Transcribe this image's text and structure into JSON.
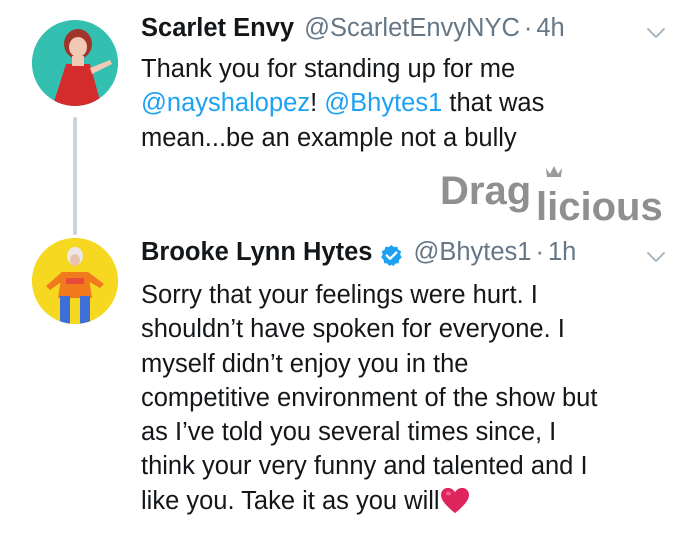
{
  "tweets": [
    {
      "display_name": "Scarlet Envy",
      "handle": "@ScarletEnvyNYC",
      "separator": "·",
      "time": "4h",
      "body": {
        "line1": "Thank you for standing up for me",
        "mention1": "@nayshalopez",
        "line2_mid": "! ",
        "mention2": "@Bhytes1",
        "line2_end": " that was",
        "line3": "mean...be an example not a bully"
      },
      "avatar_icon": "drag-queen-red-dress-avatar",
      "menu_icon": "chevron-down-icon"
    },
    {
      "display_name": "Brooke Lynn Hytes",
      "verified": true,
      "handle": "@Bhytes1",
      "separator": "·",
      "time": "1h",
      "body": {
        "lines": [
          "Sorry that your feelings were hurt. I",
          "shouldn’t have spoken for everyone. I",
          "myself didn’t enjoy you in the",
          "competitive environment of the show but",
          "as I’ve told you several times since, I",
          "think your very funny and talented and I",
          "like you.  Take it as you will"
        ],
        "emoji": "red-heart"
      },
      "avatar_icon": "drag-queen-orange-outfit-avatar",
      "menu_icon": "chevron-down-icon"
    }
  ],
  "watermark": {
    "text_a": "Drag",
    "text_b": "licious"
  },
  "colors": {
    "text": "#14171a",
    "secondary": "#657786",
    "link": "#1da1f2",
    "thread_line": "#c8d3db",
    "verified": "#1da1f2",
    "heart": "#e0245e"
  }
}
